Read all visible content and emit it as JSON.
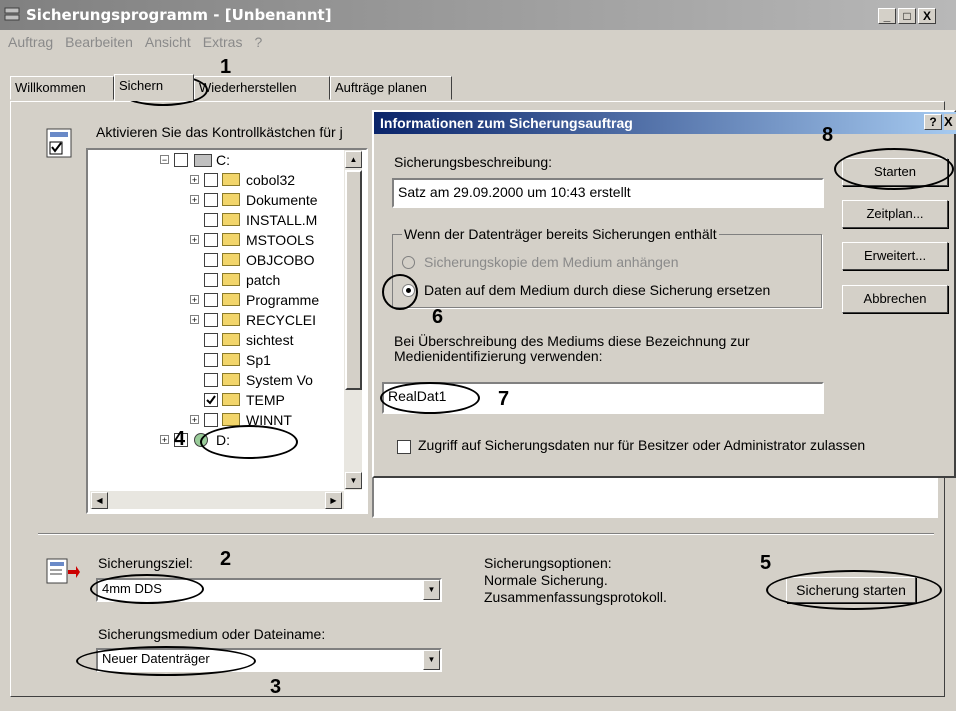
{
  "window": {
    "title": "Sicherungsprogramm - [Unbenannt]",
    "controls": [
      "_",
      "□",
      "X"
    ]
  },
  "menu": [
    "Auftrag",
    "Bearbeiten",
    "Ansicht",
    "Extras",
    "?"
  ],
  "tabs": [
    "Willkommen",
    "Sichern",
    "Wiederherstellen",
    "Aufträge planen"
  ],
  "backup_tab": {
    "instruction": "Aktivieren Sie das Kontrollkästchen für j",
    "tree": [
      {
        "label": "C:",
        "checked": false
      },
      {
        "label": "cobol32"
      },
      {
        "label": "Dokumente"
      },
      {
        "label": "INSTALL.M"
      },
      {
        "label": "MSTOOLS"
      },
      {
        "label": "OBJCOBO"
      },
      {
        "label": "patch"
      },
      {
        "label": "Programme"
      },
      {
        "label": "RECYCLEI"
      },
      {
        "label": "sichtest"
      },
      {
        "label": "Sp1"
      },
      {
        "label": "System Vo"
      },
      {
        "label": "TEMP",
        "checked": true
      },
      {
        "label": "WINNT"
      },
      {
        "label": "D:"
      }
    ],
    "target_label": "Sicherungsziel:",
    "target_value": "4mm DDS",
    "medium_label": "Sicherungsmedium oder Dateiname:",
    "medium_value": "Neuer Datenträger",
    "options_label": "Sicherungsoptionen:",
    "options_line1": "Normale Sicherung.",
    "options_line2": "Zusammenfassungsprotokoll.",
    "start_button": "Sicherung starten"
  },
  "dialog": {
    "title": "Informationen zum Sicherungsauftrag",
    "help": "?",
    "close": "X",
    "description_label": "Sicherungsbeschreibung:",
    "description_value": "Satz am 29.09.2000 um 10:43 erstellt",
    "group_label": "Wenn der Datenträger bereits Sicherungen enthält",
    "option_append": "Sicherungskopie dem Medium anhängen",
    "option_replace": "Daten auf dem Medium durch diese Sicherung ersetzen",
    "media_label_line1": "Bei Überschreibung des Mediums diese Bezeichnung zur",
    "media_label_line2": "Medienidentifizierung verwenden:",
    "media_value": "RealDat1",
    "restrict_label": "Zugriff auf Sicherungsdaten nur für Besitzer oder Administrator zulassen",
    "buttons": [
      "Starten",
      "Zeitplan...",
      "Erweitert...",
      "Abbrechen"
    ]
  },
  "annotations": [
    "1",
    "2",
    "3",
    "4",
    "5",
    "6",
    "7",
    "8"
  ]
}
